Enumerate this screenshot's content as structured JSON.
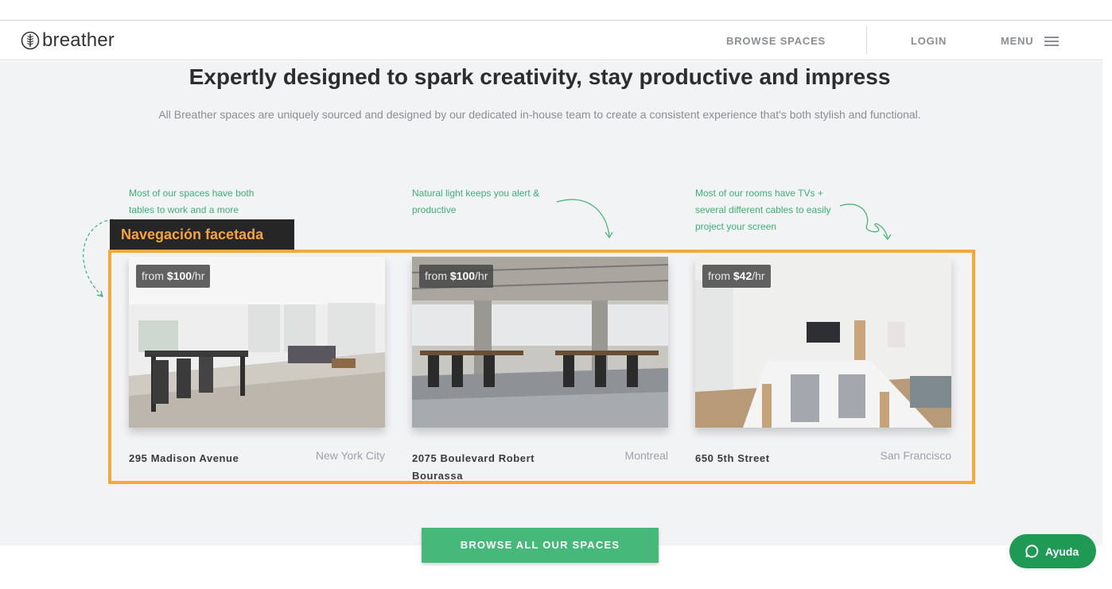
{
  "header": {
    "logo_text": "breather",
    "nav": {
      "browse_spaces": "BROWSE SPACES",
      "login": "LOGIN",
      "menu": "MENU"
    }
  },
  "hero": {
    "title": "Expertly designed to spark creativity, stay productive and impress",
    "subtitle": "All Breather spaces are uniquely sourced and designed by our dedicated in-house team to create a consistent experience that's both stylish and functional."
  },
  "annotations": [
    "Most of our spaces have both tables to work and a more",
    "Natural light keeps you alert & productive",
    "Most of our rooms have TVs + several different cables to easily project your screen"
  ],
  "facet_label": "Navegación facetada",
  "spaces": [
    {
      "price_prefix": "from ",
      "price": "$100",
      "price_suffix": "/hr",
      "address": "295 Madison Avenue",
      "city": "New York City"
    },
    {
      "price_prefix": "from ",
      "price": "$100",
      "price_suffix": "/hr",
      "address": "2075 Boulevard Robert Bourassa",
      "city": "Montreal"
    },
    {
      "price_prefix": "from ",
      "price": "$42",
      "price_suffix": "/hr",
      "address": "650 5th Street",
      "city": "San Francisco"
    }
  ],
  "cta": {
    "label": "BROWSE ALL OUR SPACES"
  },
  "help": {
    "label": "Ayuda"
  },
  "colors": {
    "accent_green": "#46b87a",
    "annotation_green": "#3bb273",
    "help_green": "#1f9a55",
    "highlight_orange": "#f5a93c",
    "facet_label_bg": "#262626"
  },
  "icons": [
    "breather-logo-icon",
    "hamburger-icon",
    "chat-bubble-icon",
    "curved-arrow-icon"
  ]
}
